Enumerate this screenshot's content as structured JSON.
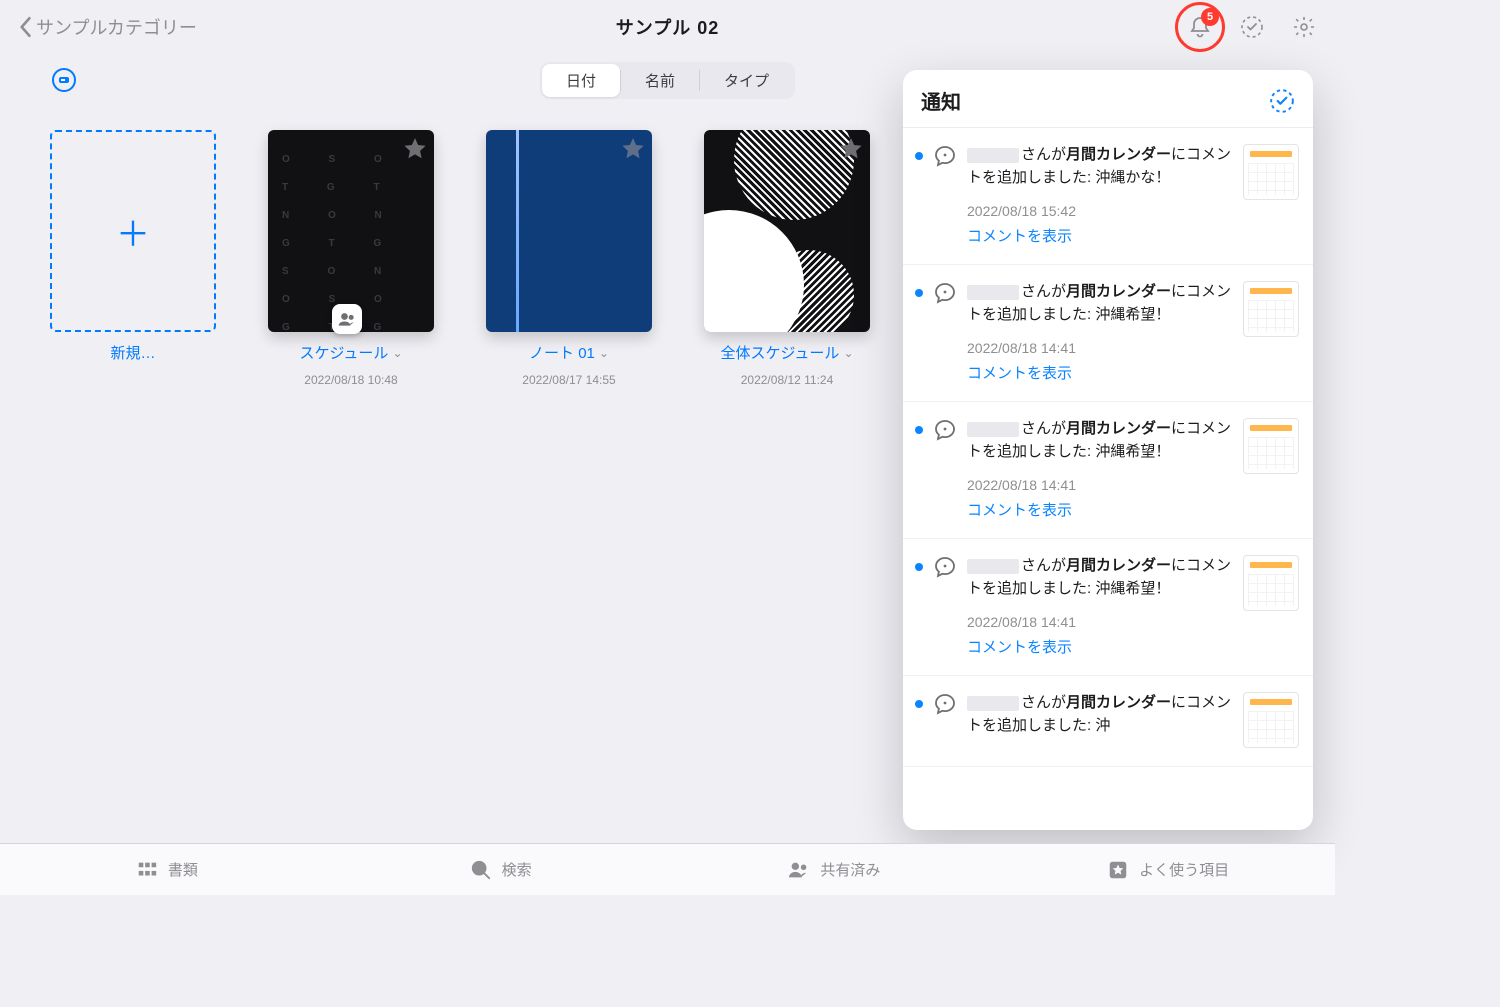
{
  "header": {
    "back_label": "サンプルカテゴリー",
    "title": "サンプル 02",
    "notification_count": "5"
  },
  "segmented": {
    "items": [
      "日付",
      "名前",
      "タイプ"
    ],
    "selected_index": 0
  },
  "documents": {
    "new_label": "新規…",
    "items": [
      {
        "name": "スケジュール",
        "date": "2022/08/18 10:48"
      },
      {
        "name": "ノート 01",
        "date": "2022/08/17 14:55"
      },
      {
        "name": "全体スケジュール",
        "date": "2022/08/12 11:24"
      }
    ]
  },
  "popover": {
    "title": "通知",
    "view_comment_label": "コメントを表示",
    "notifications": [
      {
        "middle": "さんが",
        "target": "月間カレンダー",
        "suffix": "にコメントを追加しました:",
        "body": "沖縄かな！",
        "time": "2022/08/18 15:42"
      },
      {
        "middle": "さんが",
        "target": "月間カレンダー",
        "suffix": "にコメントを追加しました:",
        "body": "沖縄希望！",
        "time": "2022/08/18 14:41"
      },
      {
        "middle": "さんが",
        "target": "月間カレンダー",
        "suffix": "にコメントを追加しました:",
        "body": "沖縄希望！",
        "time": "2022/08/18 14:41"
      },
      {
        "middle": "さんが",
        "target": "月間カレンダー",
        "suffix": "にコメントを追加しました:",
        "body": "沖縄希望！",
        "time": "2022/08/18 14:41"
      },
      {
        "middle": "さんが",
        "target": "月間カレンダー",
        "suffix": "にコメントを追加しました:",
        "body": "沖",
        "time": ""
      }
    ]
  },
  "tabs": {
    "items": [
      "書類",
      "検索",
      "共有済み",
      "よく使う項目"
    ]
  }
}
